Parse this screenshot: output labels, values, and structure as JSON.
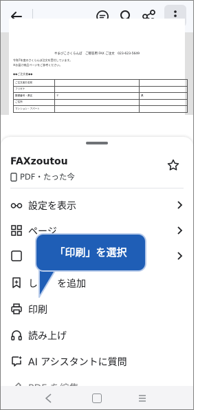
{
  "toolbar": {
    "back_icon": "arrow-left-icon",
    "icons": [
      "chat-sparkle-icon",
      "search-icon",
      "share-icon",
      "more-vertical-icon"
    ]
  },
  "pdf_preview": {
    "title": "やまびこさくらんぼ　ご贈答用 FAX ご注文　023-623-5649",
    "lines": [
      "令和7年度のさくらんぼ注文を受付しています。",
      "※お届け商品ページをご参考ください。",
      "◆◆ご注文者◆◆"
    ],
    "rows": [
      [
        "ご注文者お名前",
        "",
        ""
      ],
      [
        "フリガナ",
        "",
        ""
      ],
      [
        "郵便番号・県名",
        "〒",
        "県"
      ],
      [
        "ご住所",
        "",
        ""
      ],
      [
        "マンション・アパート",
        "",
        ""
      ]
    ]
  },
  "sheet": {
    "doc_name": "FAXzoutou",
    "doc_meta": "PDF・たった今",
    "star_icon": "star-outline-icon",
    "items": [
      {
        "label": "設定を表示",
        "icon": "glasses-icon",
        "chevron": true
      },
      {
        "label": "ページ",
        "icon": "grid-icon",
        "chevron": true
      },
      {
        "label": "",
        "icon": "layout-icon",
        "chevron": true
      },
      {
        "label": "し　　を追加",
        "icon": "bookmark-plus-icon",
        "chevron": false
      },
      {
        "label": "印刷",
        "icon": "printer-icon",
        "chevron": false
      },
      {
        "label": "読み上げ",
        "icon": "headphones-icon",
        "chevron": false
      },
      {
        "label": "AI アシスタントに質問",
        "icon": "ai-chat-icon",
        "chevron": false
      },
      {
        "label": "PDF を編集",
        "icon": "edit-icon",
        "chevron": false
      }
    ]
  },
  "callout": {
    "text": "「印刷」を選択"
  },
  "navbar": {
    "icons": [
      "nav-back-icon",
      "nav-home-icon",
      "nav-recent-icon"
    ]
  },
  "colors": {
    "callout_bg": "#1f5eb6",
    "accent": "#1a73e8"
  }
}
